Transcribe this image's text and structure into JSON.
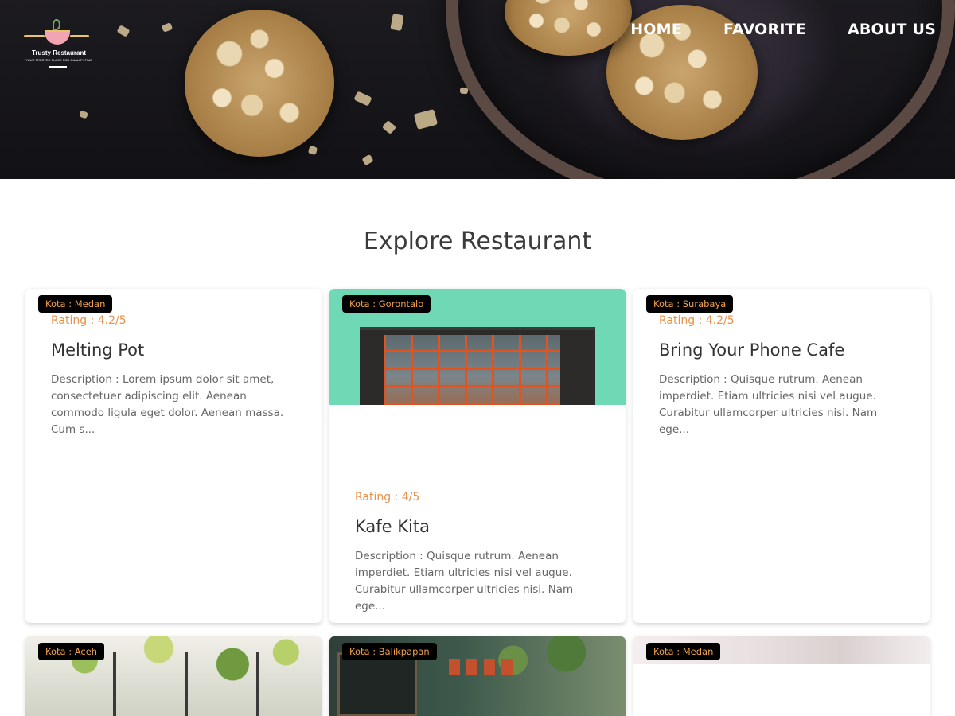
{
  "header": {
    "logo": {
      "name": "Trusty Restaurant",
      "tagline": "YOUR TRUSTED PLACE FOR QUALITY TIME"
    },
    "nav": [
      {
        "label": "HOME"
      },
      {
        "label": "FAVORITE"
      },
      {
        "label": "ABOUT US"
      }
    ]
  },
  "main": {
    "title": "Explore Restaurant",
    "restaurants": [
      {
        "city": "Kota : Medan",
        "rating": "Rating : 4.2/5",
        "name": "Melting Pot",
        "description": "Description : Lorem ipsum dolor sit amet, consectetuer adipiscing elit. Aenean commodo ligula eget dolor. Aenean massa. Cum s..."
      },
      {
        "city": "Kota : Gorontalo",
        "rating": "Rating : 4/5",
        "name": "Kafe Kita",
        "description": "Description : Quisque rutrum. Aenean imperdiet. Etiam ultricies nisi vel augue. Curabitur ullamcorper ultricies nisi. Nam ege..."
      },
      {
        "city": "Kota : Surabaya",
        "rating": "Rating : 4.2/5",
        "name": "Bring Your Phone Cafe",
        "description": "Description : Quisque rutrum. Aenean imperdiet. Etiam ultricies nisi vel augue. Curabitur ullamcorper ultricies nisi. Nam ege..."
      },
      {
        "city": "Kota : Aceh"
      },
      {
        "city": "Kota : Balikpapan"
      },
      {
        "city": "Kota : Medan"
      }
    ]
  },
  "colors": {
    "badge_bg": "#000000",
    "badge_text": "#f0a04b",
    "rating_text": "#e8914a",
    "nav_text": "#ffffff"
  }
}
